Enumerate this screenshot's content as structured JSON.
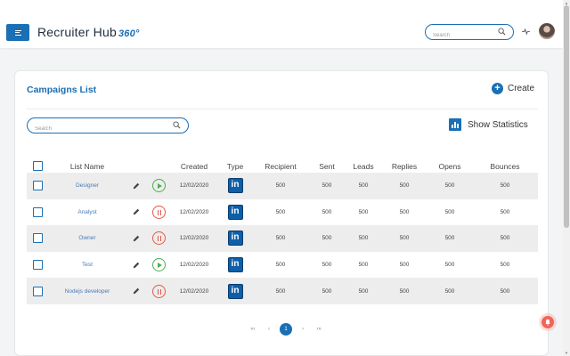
{
  "header": {
    "logo_main": "Recruiter Hub",
    "logo_badge": "360°",
    "search_placeholder": "Search"
  },
  "campaigns": {
    "title": "Campaigns List",
    "create_label": "Create",
    "search_placeholder": "Search",
    "stats_label": "Show Statistics",
    "columns": [
      "List Name",
      "",
      "",
      "Created",
      "Type",
      "Recipient",
      "Sent",
      "Leads",
      "Replies",
      "Opens",
      "Bounces"
    ],
    "type_badge": "in",
    "rows": [
      {
        "name": "Designer",
        "status": "play",
        "created": "12/02/2020",
        "recipient": "500",
        "sent": "500",
        "leads": "500",
        "replies": "500",
        "opens": "500",
        "bounces": "500"
      },
      {
        "name": "Analyst",
        "status": "pause",
        "created": "12/02/2020",
        "recipient": "500",
        "sent": "500",
        "leads": "500",
        "replies": "500",
        "opens": "500",
        "bounces": "500"
      },
      {
        "name": "Owner",
        "status": "pause",
        "created": "12/02/2020",
        "recipient": "500",
        "sent": "500",
        "leads": "500",
        "replies": "500",
        "opens": "500",
        "bounces": "500"
      },
      {
        "name": "Test",
        "status": "play",
        "created": "12/02/2020",
        "recipient": "500",
        "sent": "500",
        "leads": "500",
        "replies": "500",
        "opens": "500",
        "bounces": "500"
      },
      {
        "name": "Nodejs developer",
        "status": "pause",
        "created": "12/02/2020",
        "recipient": "500",
        "sent": "500",
        "leads": "500",
        "replies": "500",
        "opens": "500",
        "bounces": "500"
      }
    ]
  },
  "pagination": {
    "first": "«‹",
    "prev": "‹",
    "current": "1",
    "next": "›",
    "last": "›»"
  },
  "colors": {
    "brand": "#1a6fb5",
    "play": "#4caf50",
    "pause": "#e05a4a",
    "row_stripe": "#ededed"
  },
  "icons": [
    "menu-icon",
    "search-icon",
    "activity-icon",
    "avatar",
    "plus-icon",
    "bar-chart-icon",
    "pencil-icon",
    "play-icon",
    "pause-icon",
    "linkedin-icon",
    "bell-icon"
  ]
}
